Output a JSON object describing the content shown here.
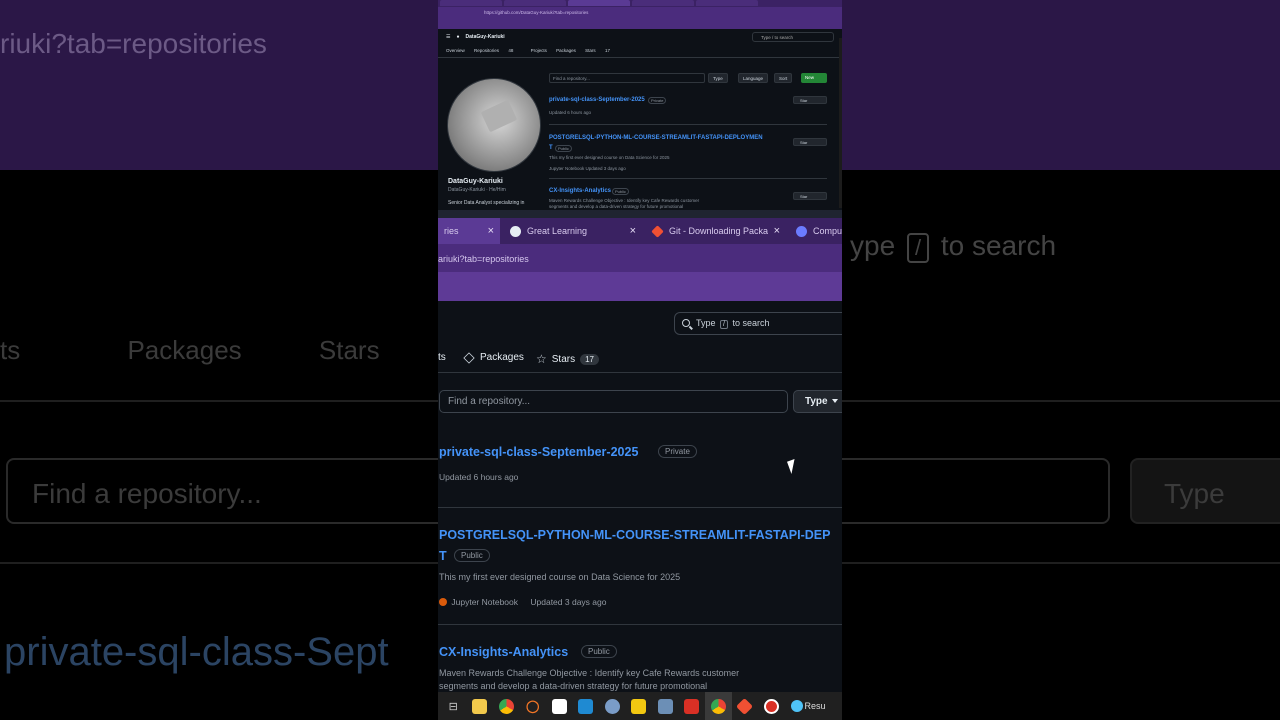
{
  "backdrop": {
    "url_fragment": "riuki?tab=repositories",
    "search_prefix": "ype",
    "search_key": "/",
    "search_suffix": "to search",
    "nav_left": "ts",
    "nav_packages": "Packages",
    "nav_stars": "Stars",
    "find_placeholder": "Find a repository...",
    "type_label": "Type",
    "repo_fragment": "private-sql-class-Sept"
  },
  "mini": {
    "url": "https://github.com/DataGuy-Kariuki?tab=repositories",
    "user": "DataGuy-Kariuki",
    "search": "Type / to search",
    "nav": [
      "Overview",
      "Repositories",
      "Projects",
      "Packages",
      "Stars"
    ],
    "repos_count": "48",
    "stars_count": "17",
    "name": "DataGuy-Kariuki",
    "handle": "DataGuy-Kariuki · He/Him",
    "bio": "Senior Data Analyst specializing in",
    "find": "Find a repository...",
    "type": "Type",
    "language": "Language",
    "sort": "Sort",
    "new": "New",
    "repo1": "private-sql-class-September-2025",
    "repo1_badge": "Private",
    "repo1_meta": "Updated 6 hours ago",
    "repo2": "POSTGRELSQL-PYTHON-ML-COURSE-STREAMLIT-FASTAPI-DEPLOYMEN",
    "repo2_t": "T",
    "repo2_badge": "Public",
    "repo2_desc": "This my first ever designed course on Data Science for 2025",
    "repo2_meta": "Jupyter Notebook   Updated 3 days ago",
    "repo3": "CX-Insights-Analytics",
    "repo3_badge": "Public",
    "repo3_desc": "Maven Rewards Challenge Objective : Identify key Cafe Rewards customer",
    "repo3_desc2": "segments and develop a data-driven strategy for future promotional",
    "star": "Star"
  },
  "tabs": [
    {
      "label": "ries",
      "close": "×"
    },
    {
      "label": "Great Learning",
      "close": "×"
    },
    {
      "label": "Git - Downloading Packa",
      "close": "×"
    },
    {
      "label": "Compu",
      "close": ""
    }
  ],
  "url": "ariuki?tab=repositories",
  "search": {
    "prefix": "Type",
    "key": "/",
    "suffix": "to search"
  },
  "nav": {
    "projects_fragment": "ts",
    "packages": "Packages",
    "stars": "Stars",
    "stars_count": "17"
  },
  "filter": {
    "placeholder": "Find a repository...",
    "type": "Type"
  },
  "repos": [
    {
      "name": "private-sql-class-September-2025",
      "badge": "Private",
      "meta": "Updated 6 hours ago"
    },
    {
      "name": "POSTGRELSQL-PYTHON-ML-COURSE-STREAMLIT-FASTAPI-DEP",
      "name_cont": "T",
      "badge": "Public",
      "desc": "This my first ever designed course on Data Science for 2025",
      "language": "Jupyter Notebook",
      "updated": "Updated 3 days ago"
    },
    {
      "name": "CX-Insights-Analytics",
      "badge": "Public",
      "desc_line1": "Maven Rewards Challenge Objective : Identify key Cafe Rewards customer",
      "desc_line2": "segments and develop a data-driven strategy for future promotional"
    }
  ],
  "taskbar": {
    "last_label": "Resu"
  },
  "colors": {
    "link": "#4493f8",
    "bg": "#0d1117",
    "browser_chrome": "#4b2c7d",
    "jupyter": "#DA5B0B"
  }
}
